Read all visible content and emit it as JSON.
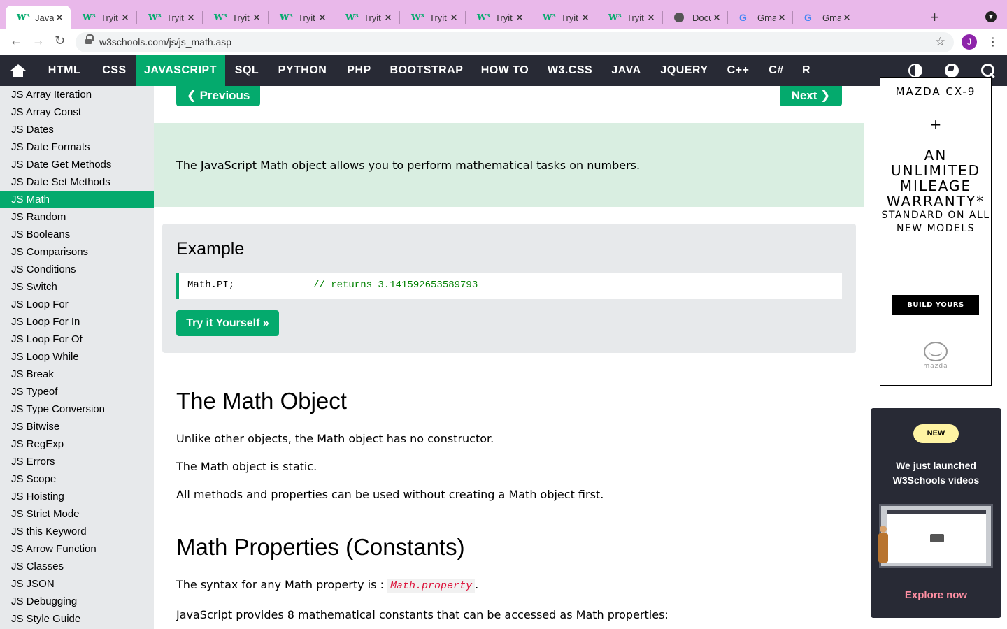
{
  "browser": {
    "tabs": [
      {
        "favicon": "w3schools",
        "title": "JavaS",
        "active": true
      },
      {
        "favicon": "w3schools",
        "title": "Tryit"
      },
      {
        "favicon": "w3schools",
        "title": "Tryit"
      },
      {
        "favicon": "w3schools",
        "title": "Tryit"
      },
      {
        "favicon": "w3schools",
        "title": "Tryit"
      },
      {
        "favicon": "w3schools",
        "title": "Tryit"
      },
      {
        "favicon": "w3schools",
        "title": "Tryit"
      },
      {
        "favicon": "w3schools",
        "title": "Tryit"
      },
      {
        "favicon": "w3schools",
        "title": "Tryit"
      },
      {
        "favicon": "w3schools",
        "title": "Tryit"
      },
      {
        "favicon": "globe",
        "title": "Docu"
      },
      {
        "favicon": "google",
        "title": "Gmai"
      },
      {
        "favicon": "google",
        "title": "Gmai"
      }
    ],
    "url": "w3schools.com/js/js_math.asp",
    "profile_initial": "J",
    "tabstrip_color": "#e9b8ea"
  },
  "topnav": {
    "items": [
      "HTML",
      "CSS",
      "JAVASCRIPT",
      "SQL",
      "PYTHON",
      "PHP",
      "BOOTSTRAP",
      "HOW TO",
      "W3.CSS",
      "JAVA",
      "JQUERY",
      "C++",
      "C#",
      "R"
    ],
    "active": "JAVASCRIPT",
    "bg_color": "#282a35",
    "accent_color": "#04aa6d"
  },
  "sidebar": {
    "items": [
      "JS Array Iteration",
      "JS Array Const",
      "JS Dates",
      "JS Date Formats",
      "JS Date Get Methods",
      "JS Date Set Methods",
      "JS Math",
      "JS Random",
      "JS Booleans",
      "JS Comparisons",
      "JS Conditions",
      "JS Switch",
      "JS Loop For",
      "JS Loop For In",
      "JS Loop For Of",
      "JS Loop While",
      "JS Break",
      "JS Typeof",
      "JS Type Conversion",
      "JS Bitwise",
      "JS RegExp",
      "JS Errors",
      "JS Scope",
      "JS Hoisting",
      "JS Strict Mode",
      "JS this Keyword",
      "JS Arrow Function",
      "JS Classes",
      "JS JSON",
      "JS Debugging",
      "JS Style Guide"
    ],
    "active": "JS Math"
  },
  "main": {
    "prev_label": "❮ Previous",
    "next_label": "Next ❯",
    "intro": "The JavaScript Math object allows you to perform mathematical tasks on numbers.",
    "example": {
      "heading": "Example",
      "code": "Math.PI;",
      "comment": "// returns 3.141592653589793",
      "try_label": "Try it Yourself »"
    },
    "math_object": {
      "heading": "The Math Object",
      "paragraphs": [
        "Unlike other objects, the Math object has no constructor.",
        "The Math object is static.",
        "All methods and properties can be used without creating a Math object first."
      ]
    },
    "math_properties": {
      "heading": "Math Properties (Constants)",
      "syntax_prefix": "The syntax for any Math property is :",
      "syntax_code": "Math.property",
      "syntax_suffix": ".",
      "constants_text": "JavaScript provides 8 mathematical constants that can be accessed as Math properties:"
    }
  },
  "ads": {
    "mazda": {
      "brand": "MAZDA CX-9",
      "plus": "+",
      "headline": "AN UNLIMITED MILEAGE WARRANTY*",
      "subline": "STANDARD ON ALL NEW MODELS",
      "cta": "BUILD YOURS",
      "logo_word": "mazda"
    },
    "w3videos": {
      "badge": "NEW",
      "title": "We just launched W3Schools videos",
      "link": "Explore now"
    }
  }
}
